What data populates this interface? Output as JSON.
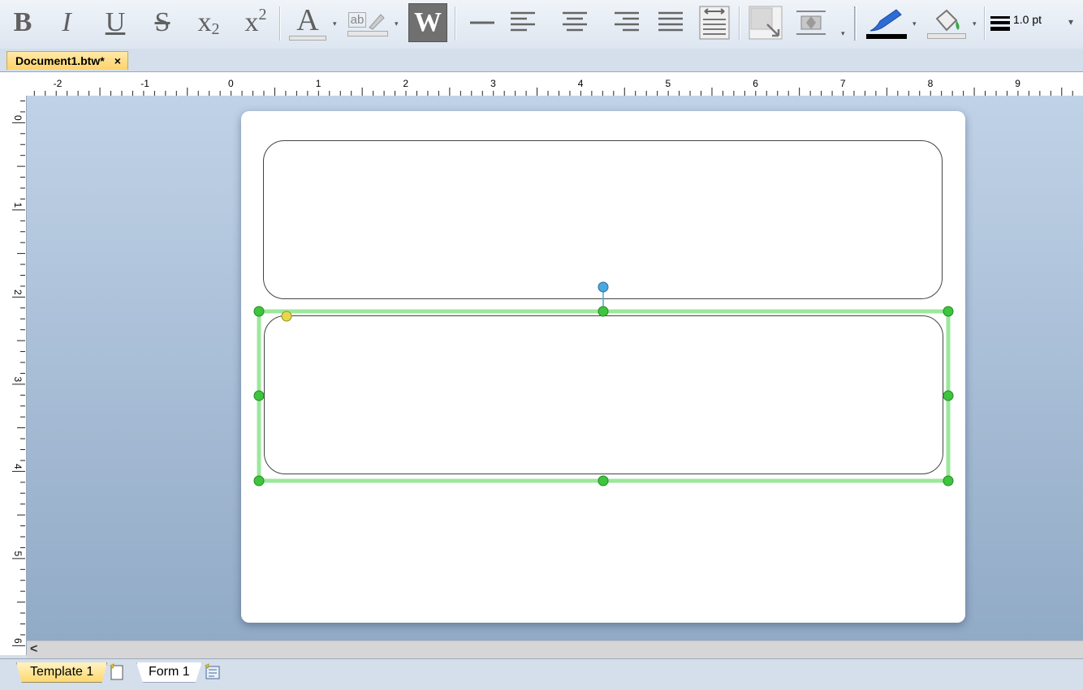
{
  "toolbar": {
    "bold": "B",
    "italic": "I",
    "underline": "U",
    "strikethrough": "S",
    "subscript_base": "x",
    "subscript_sub": "2",
    "superscript_base": "x",
    "superscript_sup": "2",
    "font_color_letter": "A",
    "highlight_text": "ab",
    "word_wrap_letter": "W",
    "line_weight": "1.0 pt",
    "accent_color": "#2e6bd6"
  },
  "document_tab": {
    "title": "Document1.btw*",
    "close": "×"
  },
  "ruler_top_labels": [
    "-2",
    "-1",
    "0",
    "1",
    "2",
    "3",
    "4",
    "5",
    "6",
    "7",
    "8",
    "9"
  ],
  "ruler_left_labels": [
    "0",
    "1",
    "2",
    "3",
    "4",
    "5",
    "6"
  ],
  "selection": {
    "handle_color": "#3ec43e",
    "outline_color": "#9ce89c",
    "rotate_handle_color": "#4aa8e0",
    "corner_handle_color": "#e6d84a"
  },
  "scrollbar": {
    "left_arrow": "<"
  },
  "sheet_tabs": {
    "template": "Template 1",
    "form": "Form 1"
  }
}
